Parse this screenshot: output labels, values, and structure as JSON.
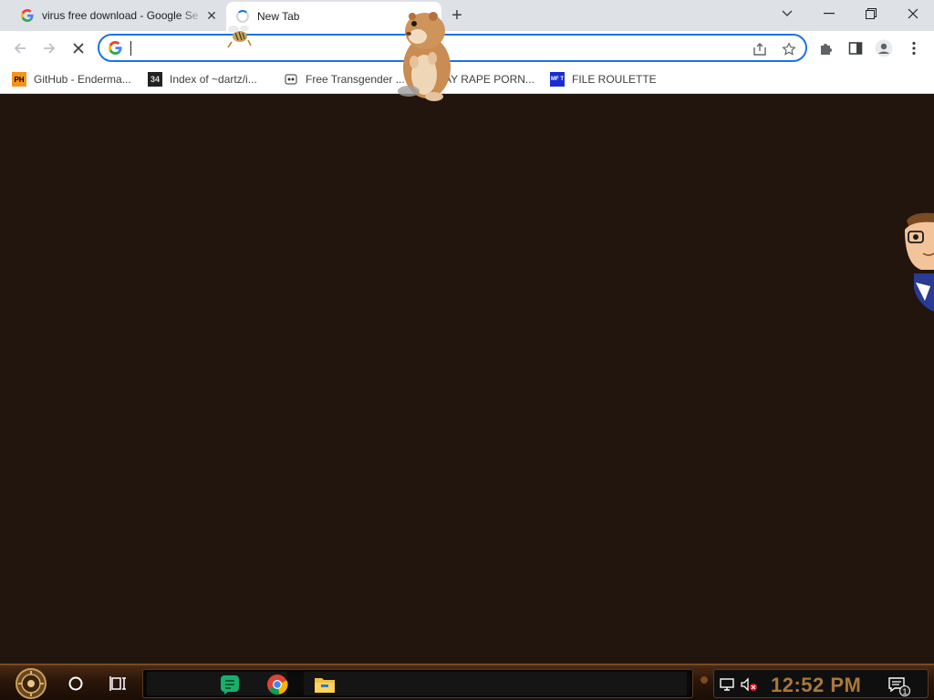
{
  "browser": {
    "tabs": [
      {
        "title": "virus free download - Google Se",
        "favicon": "google-g-icon",
        "state": "inactive"
      },
      {
        "title": "New Tab",
        "favicon": "loading-spinner-icon",
        "state": "active"
      }
    ],
    "new_tab_symbol": "+",
    "close_tab_symbol": "✕",
    "window_controls": {
      "tab_search": "⌄",
      "minimize": "—",
      "restore": "❐",
      "close": "✕"
    },
    "toolbar": {
      "back_icon": "arrow-left-icon",
      "forward_icon": "arrow-right-icon",
      "stop_icon": "close-stop-icon",
      "omnibox_value": "",
      "omnibox_icon": "google-g-icon"
    },
    "bookmarks": [
      {
        "label": "GitHub - Enderma...",
        "icon_text": "PH"
      },
      {
        "label": "Index of ~dartz/i...",
        "icon_text": "34"
      },
      {
        "label": "Free Transgender ...",
        "icon_text": ""
      },
      {
        "label": "AY RAPE PORN...",
        "icon_text": ""
      },
      {
        "label": "FILE ROULETTE",
        "icon_text": "MF T"
      }
    ]
  },
  "page": {
    "background": "#21150e"
  },
  "overlays": [
    "hamster-sprite",
    "bee-sprite",
    "cartoon-man-sprite"
  ],
  "taskbar": {
    "start_icon": "steampunk-start-orb-icon",
    "search_icon": "cortana-circle-icon",
    "taskview_icon": "task-view-icon",
    "apps": [
      "green-chat-app-icon",
      "chrome-icon",
      "file-explorer-icon"
    ],
    "tray_icons": [
      "network-icon",
      "volume-muted-icon",
      "notifications-icon"
    ],
    "clock": "12:52 PM",
    "notification_count": "1",
    "accent": "#a9783c"
  },
  "colors": {
    "tabstrip": "#dee1e6",
    "focus_blue": "#1a73e8",
    "page_bg": "#21150e"
  }
}
